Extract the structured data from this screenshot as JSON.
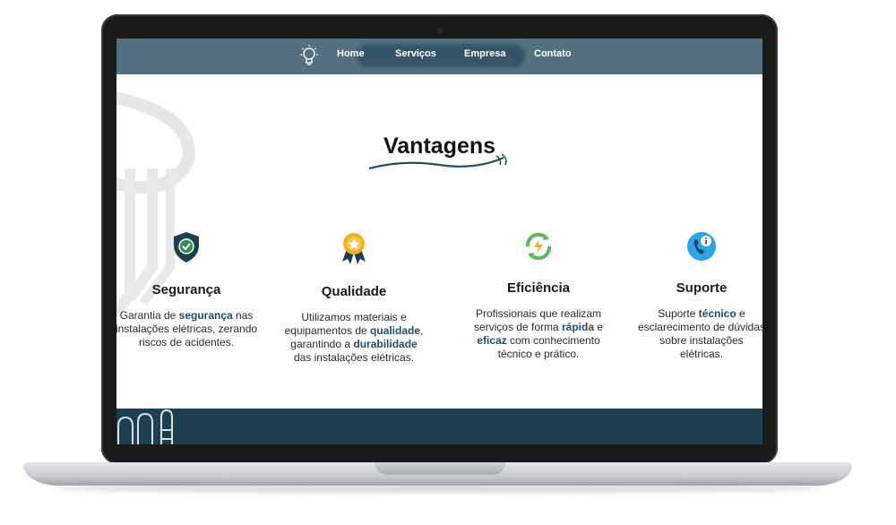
{
  "nav": {
    "links": [
      "Home",
      "Serviços",
      "Empresa",
      "Contato"
    ]
  },
  "section": {
    "title": "Vantagens"
  },
  "cards": [
    {
      "icon": "shield-check-icon",
      "title": "Segurança",
      "desc": [
        "Garantia de ",
        "segurança",
        " nas instalações elétricas, zerando riscos de acidentes."
      ]
    },
    {
      "icon": "medal-star-icon",
      "title": "Qualidade",
      "desc": [
        "Utilizamos materiais e equipamentos de ",
        "qualidade",
        ", garantindo a ",
        "durabilidade",
        " das instalações elétricas."
      ]
    },
    {
      "icon": "efficiency-bolt-icon",
      "title": "Eficiência",
      "desc": [
        "Profissionais que realizam serviços de forma ",
        "rápida",
        " e ",
        "eficaz",
        " com conhecimento técnico e prático."
      ]
    },
    {
      "icon": "support-phone-icon",
      "title": "Suporte",
      "desc": [
        "Suporte ",
        "técnico",
        " e esclarecimento de dúvidas sobre instalações elétricas."
      ]
    }
  ],
  "colors": {
    "nav": "#52707f",
    "accent": "#1f4d63",
    "footer": "#1d3f4f"
  }
}
